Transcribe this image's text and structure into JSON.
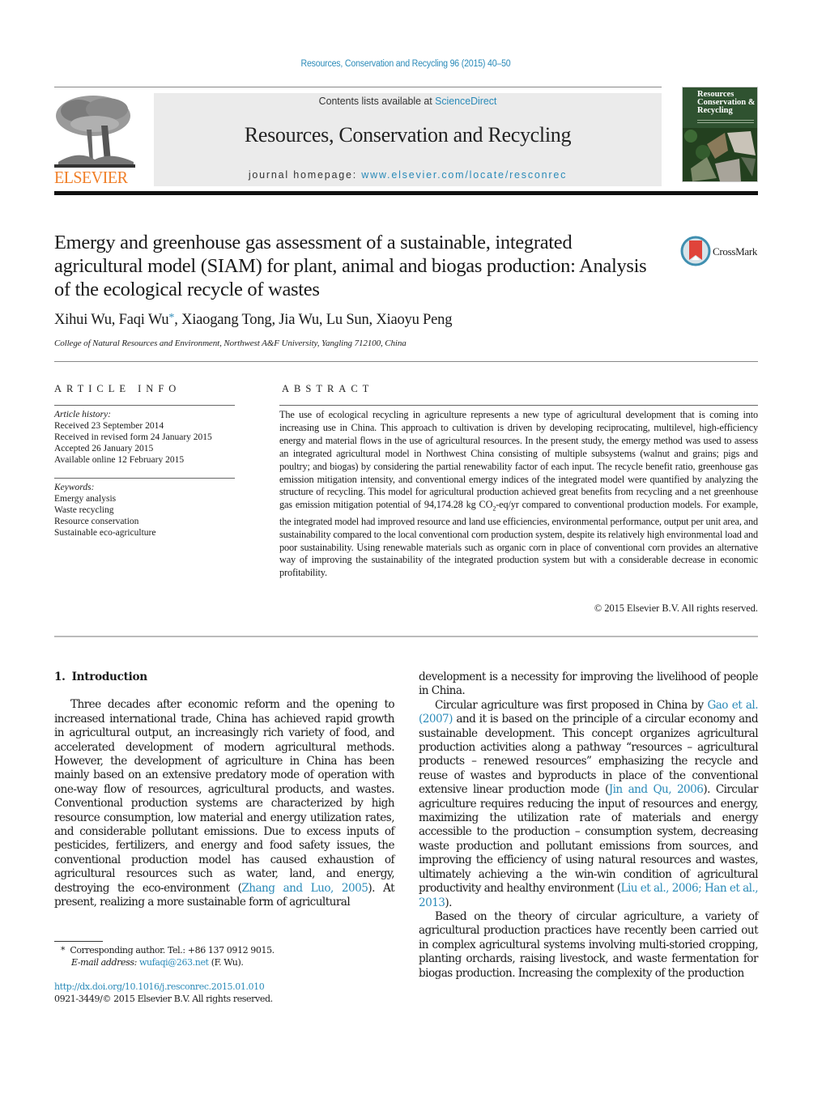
{
  "header": {
    "citation": "Resources, Conservation and Recycling 96 (2015) 40–50",
    "contents_prefix": "Contents lists available at ",
    "contents_link": "ScienceDirect",
    "journal_title": "Resources, Conservation and Recycling",
    "homepage_prefix": "journal homepage: ",
    "homepage_link": "www.elsevier.com/locate/resconrec",
    "publisher_name": "ELSEVIER",
    "cover_title_lines": [
      "Resources",
      "Conservation &",
      "Recycling"
    ],
    "colors": {
      "link": "#2a8ab8",
      "publisher": "#f07e26",
      "cover": "#2f5230"
    }
  },
  "article": {
    "title": "Emergy and greenhouse gas assessment of a sustainable, integrated agricultural model (SIAM) for plant, animal and biogas production: Analysis of the ecological recycle of wastes",
    "crossmark_label": "CrossMark",
    "authors_before_star": "Xihui Wu, Faqi Wu",
    "author_star": "*",
    "authors_after_star": ", Xiaogang Tong, Jia Wu, Lu Sun, Xiaoyu Peng",
    "affiliation": "College of Natural Resources and Environment, Northwest A&F University, Yangling 712100, China"
  },
  "article_info": {
    "heading": "ARTICLE INFO",
    "history_label": "Article history:",
    "history": [
      "Received 23 September 2014",
      "Received in revised form 24 January 2015",
      "Accepted 26 January 2015",
      "Available online 12 February 2015"
    ],
    "keywords_label": "Keywords:",
    "keywords": [
      "Emergy analysis",
      "Waste recycling",
      "Resource conservation",
      "Sustainable eco-agriculture"
    ]
  },
  "abstract": {
    "heading": "ABSTRACT",
    "text_part1": "The use of ecological recycling in agriculture represents a new type of agricultural development that is coming into increasing use in China. This approach to cultivation is driven by developing reciprocating, multilevel, high-efficiency energy and material flows in the use of agricultural resources. In the present study, the emergy method was used to assess an integrated agricultural model in Northwest China consisting of multiple subsystems (walnut and grains; pigs and poultry; and biogas) by considering the partial renewability factor of each input. The recycle benefit ratio, greenhouse gas emission mitigation intensity, and conventional emergy indices of the integrated model were quantified by analyzing the structure of recycling. This model for agricultural production achieved great benefits from recycling and a net greenhouse gas emission mitigation potential of 94,174.28 kg CO",
    "text_sub": "2",
    "text_part2": "-eq/yr compared to conventional production models. For example, the integrated model had improved resource and land use efficiencies, environmental performance, output per unit area, and sustainability compared to the local conventional corn production system, despite its relatively high environmental load and poor sustainability. Using renewable materials such as organic corn in place of conventional corn provides an alternative way of improving the sustainability of the integrated production system but with a considerable decrease in economic profitability.",
    "copyright": "© 2015 Elsevier B.V. All rights reserved."
  },
  "body": {
    "section_number": "1.",
    "section_title": "Introduction",
    "p1_a": "Three decades after economic reform and the opening to increased international trade, China has achieved rapid growth in agricultural output, an increasingly rich variety of food, and accelerated development of modern agricultural methods. However, the development of agriculture in China has been mainly based on an extensive predatory mode of operation with one-way flow of resources, agricultural products, and wastes. Conventional production systems are characterized by high resource consumption, low material and energy utilization rates, and considerable pollutant emissions. Due to excess inputs of pesticides, fertilizers, and energy and food safety issues, the conventional production model has caused exhaustion of agricultural resources such as water, land, and energy, destroying the eco-environment (",
    "p1_ref": "Zhang and Luo, 2005",
    "p1_b": "). At present, realizing a more sustainable form of agricultural",
    "p1_cont": "development is a necessity for improving the livelihood of people in China.",
    "p2_a": "Circular agriculture was first proposed in China by ",
    "p2_ref1": "Gao et al. (2007)",
    "p2_b": " and it is based on the principle of a circular economy and sustainable development. This concept organizes agricultural production activities along a pathway “resources – agricultural products – renewed resources” emphasizing the recycle and reuse of wastes and byproducts in place of the conventional extensive linear production mode (",
    "p2_ref2": "Jin and Qu, 2006",
    "p2_c": "). Circular agriculture requires reducing the input of resources and energy, maximizing the utilization rate of materials and energy accessible to the production – consumption system, decreasing waste production and pollutant emissions from sources, and improving the efficiency of using natural resources and wastes, ultimately achieving a the win-win condition of agricultural productivity and healthy environment (",
    "p2_ref3": "Liu et al., 2006; Han et al., 2013",
    "p2_d": ").",
    "p3": "Based on the theory of circular agriculture, a variety of agricultural production practices have recently been carried out in complex agricultural systems involving multi-storied cropping, planting orchards, raising livestock, and waste fermentation for biogas production. Increasing the complexity of the production"
  },
  "footnotes": {
    "star": "*",
    "corresponding": "Corresponding author. Tel.: +86 137 0912 9015.",
    "email_label": "E-mail address: ",
    "email": "wufaqi@263.net",
    "email_suffix": " (F. Wu).",
    "doi": "http://dx.doi.org/10.1016/j.resconrec.2015.01.010",
    "issn": "0921-3449/© 2015 Elsevier B.V. All rights reserved."
  }
}
